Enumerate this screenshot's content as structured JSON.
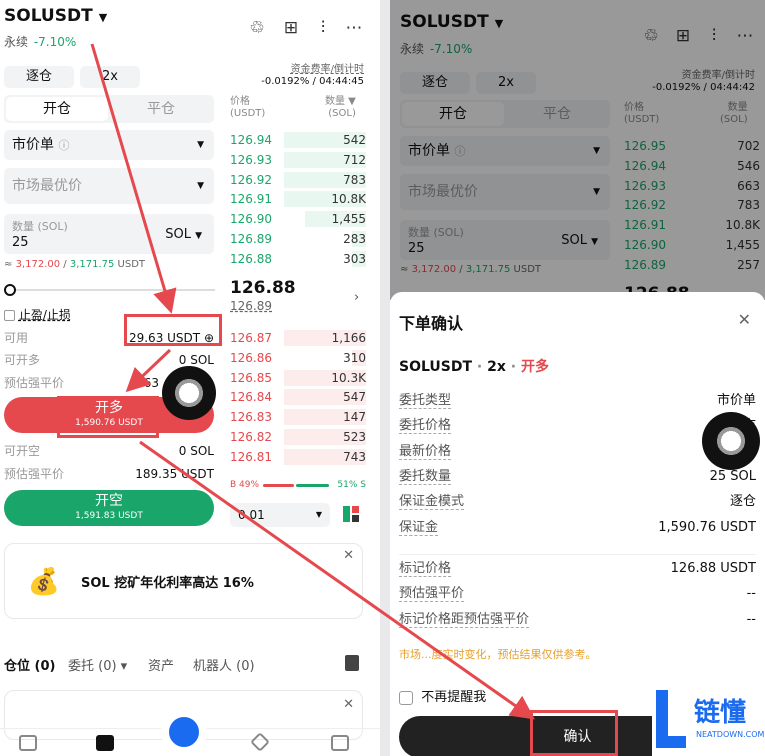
{
  "left": {
    "symbol": "SOLUSDT",
    "contract_type": "永续",
    "change": "-7.10%",
    "margin_mode": "逐仓",
    "leverage": "2x",
    "funding_label": "资金费率/倒计时",
    "funding_value": "-0.0192% / 04:44:45",
    "tab_open": "开仓",
    "tab_close": "平仓",
    "order_type": "市价单",
    "price_placeholder": "市场最优价",
    "qty_label": "数量 (SOL)",
    "qty_value": "25",
    "qty_unit": "SOL",
    "approx_prefix": "≈ ",
    "approx_low": "3,172.00",
    "approx_sep": " / ",
    "approx_high": "3,171.75",
    "approx_unit": " USDT",
    "slider_progress": 0,
    "tpsl": "止盈/止损",
    "available_label": "可用",
    "available_value": "29.63 USDT",
    "can_long_label": "可开多",
    "can_long_value": "0 SOL",
    "liq_label": "预估强平价",
    "liq_long_value": "63",
    "long_btn": "开多",
    "long_amt": "1,590.76 USDT",
    "can_short_label": "可开空",
    "can_short_value": "0 SOL",
    "liq_short_value": "189.35 USDT",
    "short_btn": "开空",
    "short_amt": "1,591.83 USDT",
    "ob_price_hdr": "价格",
    "ob_price_unit": "(USDT)",
    "ob_qty_hdr": "数量",
    "ob_qty_unit": "(SOL)",
    "asks": [
      {
        "p": "126.94",
        "q": "542",
        "d": 0.6
      },
      {
        "p": "126.93",
        "q": "712",
        "d": 0.6
      },
      {
        "p": "126.92",
        "q": "783",
        "d": 0.6
      },
      {
        "p": "126.91",
        "q": "10.8K",
        "d": 0.6
      },
      {
        "p": "126.90",
        "q": "1,455",
        "d": 0.45
      },
      {
        "p": "126.89",
        "q": "283",
        "d": 0.1
      },
      {
        "p": "126.88",
        "q": "303",
        "d": 0.1
      }
    ],
    "last_price": "126.88",
    "mark_price": "126.89",
    "bids": [
      {
        "p": "126.87",
        "q": "1,166",
        "d": 0.6
      },
      {
        "p": "126.86",
        "q": "310",
        "d": 0.1
      },
      {
        "p": "126.85",
        "q": "10.3K",
        "d": 0.6
      },
      {
        "p": "126.84",
        "q": "547",
        "d": 0.6
      },
      {
        "p": "126.83",
        "q": "147",
        "d": 0.6
      },
      {
        "p": "126.82",
        "q": "523",
        "d": 0.6
      },
      {
        "p": "126.81",
        "q": "743",
        "d": 0.6
      }
    ],
    "ratio_b": "B 49%",
    "ratio_s": "51% S",
    "ratio_b_pct": 49,
    "tick": "0.01",
    "promo": "SOL 挖矿年化利率高达 16%",
    "tabs": [
      {
        "label": "仓位",
        "count": "(0)"
      },
      {
        "label": "委托",
        "count": "(0)"
      },
      {
        "label": "资产",
        "count": ""
      },
      {
        "label": "机器人",
        "count": "(0)"
      }
    ]
  },
  "right": {
    "symbol": "SOLUSDT",
    "contract_type": "永续",
    "change": "-7.10%",
    "margin_mode": "逐仓",
    "leverage": "2x",
    "funding_label": "资金费率/倒计时",
    "funding_value": "-0.0192% / 04:44:42",
    "tab_open": "开仓",
    "tab_close": "平仓",
    "order_type": "市价单",
    "price_placeholder": "市场最优价",
    "qty_label": "数量 (SOL)",
    "qty_value": "25",
    "qty_unit": "SOL",
    "approx_prefix": "≈ ",
    "approx_low": "3,172.00",
    "approx_sep": " / ",
    "approx_high": "3,171.75",
    "approx_unit": " USDT",
    "ob_price_hdr": "价格",
    "ob_price_unit": "(USDT)",
    "ob_qty_hdr": "数量",
    "ob_qty_unit": "(SOL)",
    "asks": [
      {
        "p": "126.95",
        "q": "702"
      },
      {
        "p": "126.94",
        "q": "546"
      },
      {
        "p": "126.93",
        "q": "663"
      },
      {
        "p": "126.92",
        "q": "783"
      },
      {
        "p": "126.91",
        "q": "10.8K"
      },
      {
        "p": "126.90",
        "q": "1,455"
      },
      {
        "p": "126.89",
        "q": "257"
      }
    ],
    "last_price": "126.88",
    "modal": {
      "title": "下单确认",
      "symbol": "SOLUSDT",
      "sep1": " · ",
      "leverage": "2x",
      "sep2": " · ",
      "side": "开多",
      "rows": [
        {
          "k": "委托类型",
          "v": "市价单"
        },
        {
          "k": "委托价格",
          "v": "市"
        },
        {
          "k": "最新价格",
          "v": "126.8"
        },
        {
          "k": "委托数量",
          "v": "25 SOL"
        },
        {
          "k": "保证金模式",
          "v": "逐仓"
        },
        {
          "k": "保证金",
          "v": "1,590.76 USDT"
        }
      ],
      "rows2": [
        {
          "k": "标记价格",
          "v": "126.88 USDT"
        },
        {
          "k": "预估强平价",
          "v": "--"
        },
        {
          "k": "标记价格距预估强平价",
          "v": "--"
        }
      ],
      "note": "市场...度实时变化，预估结果仅供参考。",
      "dont_remind": "不再提醒我",
      "confirm": "确认"
    },
    "watermark": "链懂",
    "watermark_sub": "NEATDOWN.COM"
  },
  "colors": {
    "green": "#1aa56a",
    "red": "#e5484d"
  }
}
